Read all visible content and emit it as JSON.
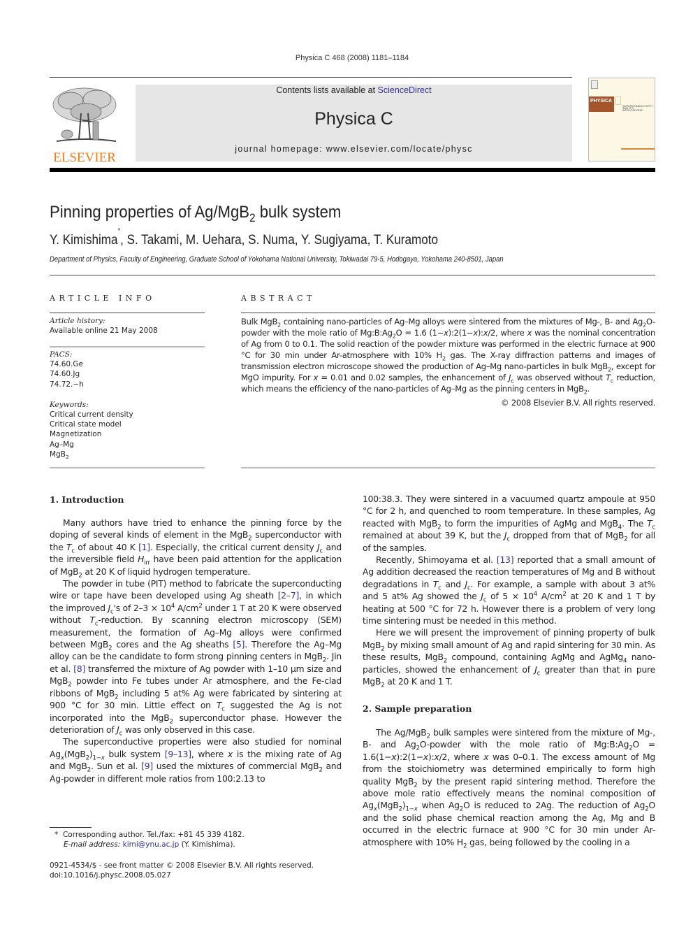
{
  "journal_citation": "Physica C  468 (2008) 1181–1184",
  "header": {
    "publisher_logo_text": "ELSEVIER",
    "contents_prefix": "Contents lists available at ",
    "contents_link": "ScienceDirect",
    "journal_title": "Physica C",
    "homepage": "journal homepage: www.elsevier.com/locate/physc",
    "cover_title": "PHYSICA",
    "cover_subtitle": "SUPERCONDUCTIVITY AND ITS APPLICATIONS",
    "colors": {
      "elsevier_orange": "#f07c1a",
      "link_blue": "#2f3191",
      "banner_gray": "#e6e6e6",
      "cover_band": "#a4552a"
    }
  },
  "article": {
    "title_pre": "Pinning properties of Ag/MgB",
    "title_sub": "2",
    "title_post": " bulk system",
    "authors_first": "Y. Kimishima",
    "authors_mark": "*",
    "authors_rest": ", S. Takami, M. Uehara, S. Numa, Y. Sugiyama, T. Kuramoto",
    "affiliation": "Department of Physics, Faculty of Engineering, Graduate School of Yokohama National University, Tokiwadai 79-5, Hodogaya, Yokohama 240-8501, Japan"
  },
  "article_info": {
    "heading": "ARTICLE INFO",
    "history_label": "Article history:",
    "history_value": "Available online 21 May 2008",
    "pacs_label": "PACS:",
    "pacs": [
      "74.60.Ge",
      "74.60.Jg",
      "74.72.−h"
    ],
    "keywords_label": "Keywords:",
    "keywords": [
      "Critical current density",
      "Critical state model",
      "Magnetization",
      "Ag–Mg"
    ],
    "keyword_last_pre": "MgB",
    "keyword_last_sub": "2"
  },
  "abstract": {
    "heading": "ABSTRACT",
    "copyright": "© 2008 Elsevier B.V. All rights reserved."
  },
  "sections": {
    "intro_heading": "1. Introduction",
    "sample_heading": "2. Sample preparation"
  },
  "footnotes": {
    "corresponding": "Corresponding author. Tel./fax: +81 45 339 4182.",
    "email_label": "E-mail address:",
    "email": "kimi@ynu.ac.jp",
    "email_owner": " (Y. Kimishima).",
    "front_matter": "0921-4534/$ - see front matter © 2008 Elsevier B.V. All rights reserved.",
    "doi": "doi:10.1016/j.physc.2008.05.027"
  }
}
